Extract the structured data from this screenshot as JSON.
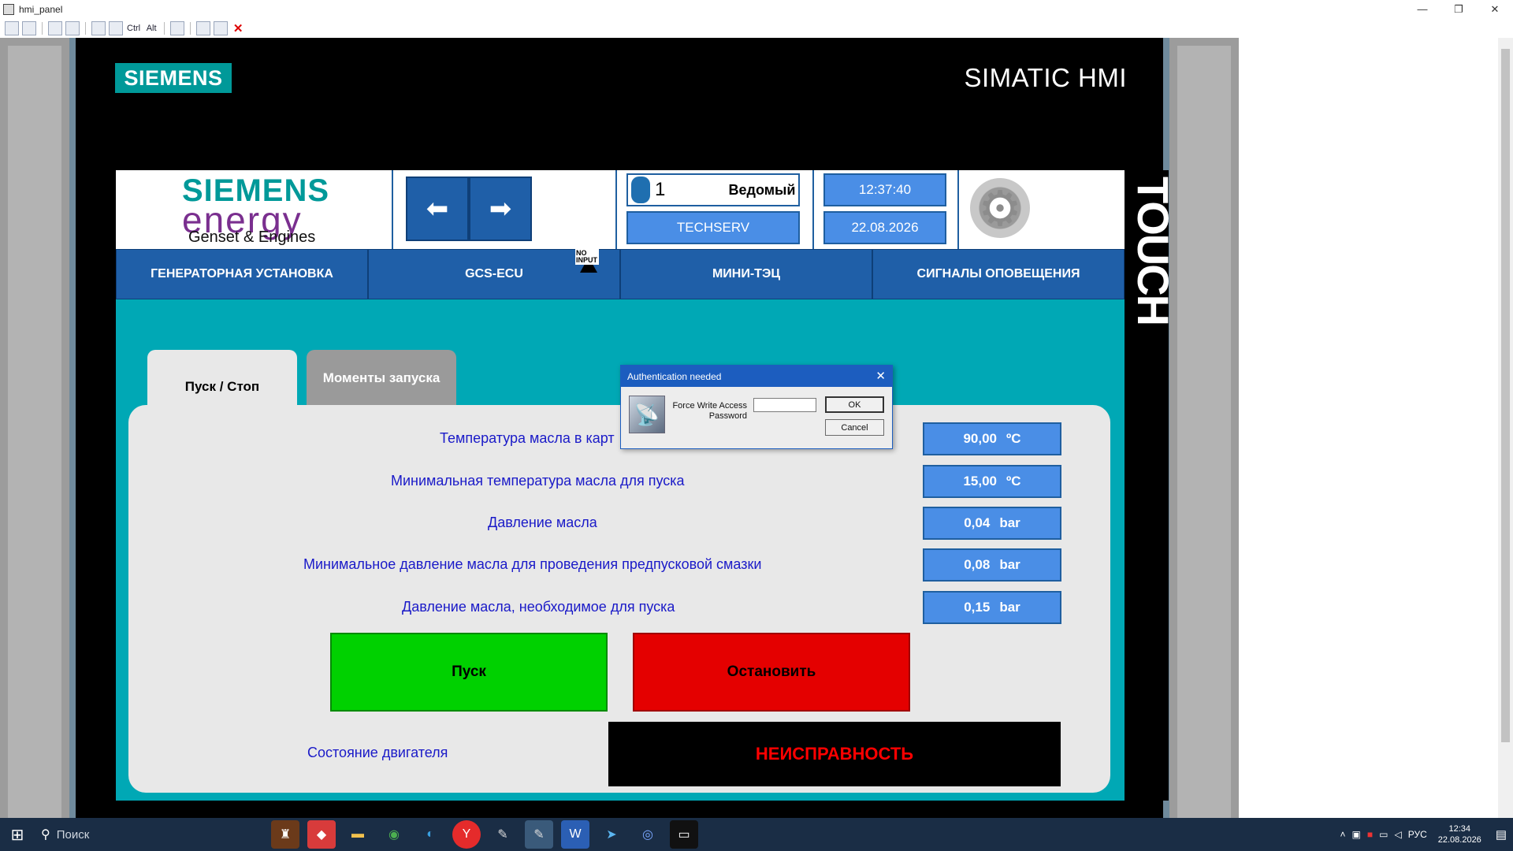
{
  "window": {
    "title": "hmi_panel",
    "controls": [
      "—",
      "❐",
      "✕"
    ]
  },
  "toolbar": {
    "ctrl_label": "Ctrl",
    "alt_label": "Alt"
  },
  "panel": {
    "brand": "SIEMENS",
    "model": "SIMATIC HMI",
    "touch_label": "TOUCH"
  },
  "header": {
    "logo_line1": "SIEMENS",
    "logo_line2": "energy",
    "logo_line3": "Genset & Engines",
    "back_arrow": "⬅",
    "forward_arrow": "➡",
    "user_id": "1",
    "user_role": "Ведомый",
    "user_name": "TECHSERV",
    "time": "12:37:40",
    "date": "22.08.2026"
  },
  "menu": {
    "items": [
      "ГЕНЕРАТОРНАЯ УСТАНОВКА",
      "GCS-ECU",
      "МИНИ-ТЭЦ",
      "СИГНАЛЫ ОПОВЕЩЕНИЯ"
    ],
    "no_input_text": "NO INPUT"
  },
  "tabs": {
    "active": "Пуск / Стоп",
    "inactive": "Моменты запуска"
  },
  "params": [
    {
      "label": "Температура масла в карт",
      "value": "90,00",
      "unit": "ºC"
    },
    {
      "label": "Минимальная температура масла для пуска",
      "value": "15,00",
      "unit": "ºC"
    },
    {
      "label": "Давление масла",
      "value": "0,04",
      "unit": "bar"
    },
    {
      "label": "Минимальное давление масла для проведения предпусковой смазки",
      "value": "0,08",
      "unit": "bar"
    },
    {
      "label": "Давление масла, необходимое для пуска",
      "value": "0,15",
      "unit": "bar"
    }
  ],
  "actions": {
    "start": "Пуск",
    "stop": "Остановить"
  },
  "engine_state": {
    "label": "Состояние двигателя",
    "value": "НЕИСПРАВНОСТЬ"
  },
  "dialog": {
    "title": "Authentication needed",
    "field_label_line1": "Force Write Access",
    "field_label_line2": "Password",
    "password_value": "",
    "ok": "OK",
    "cancel": "Cancel"
  },
  "taskbar": {
    "search_placeholder": "Поиск",
    "language": "РУС",
    "time": "12:34",
    "date": "22.08.2026"
  },
  "colors": {
    "hmi_blue": "#1f5fa8",
    "field_blue": "#4a8ee6",
    "screen_teal": "#00a8b5",
    "start_green": "#00d100",
    "stop_red": "#e40000",
    "fault_red": "#ff0000"
  }
}
